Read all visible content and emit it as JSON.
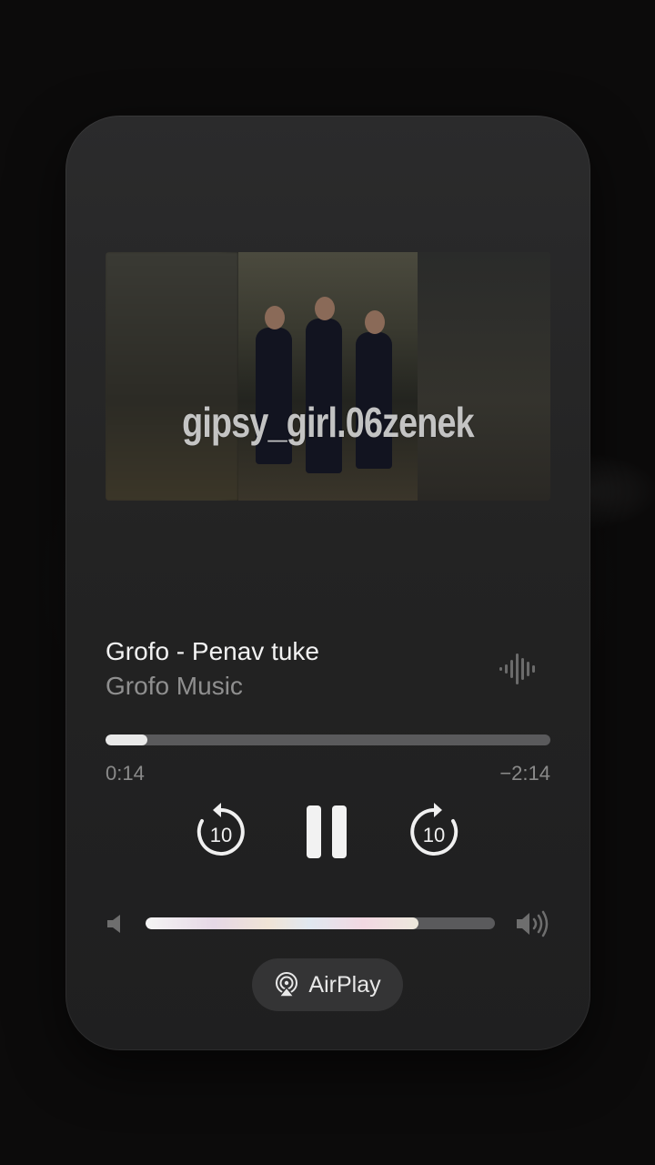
{
  "now_playing": {
    "title": "Grofo - Penav tuke",
    "artist": "Grofo Music",
    "artwork_watermark": "gipsy_girl.06zenek",
    "elapsed": "0:14",
    "remaining": "−2:14",
    "progress_fraction": 0.095
  },
  "controls": {
    "skip_back_seconds": "10",
    "skip_forward_seconds": "10",
    "state_icon": "pause-icon"
  },
  "volume": {
    "level_fraction": 0.78
  },
  "airplay": {
    "label": "AirPlay"
  },
  "colors": {
    "card_bg": "#262627",
    "track": "#5a5a5c",
    "fill": "#e9e9e9"
  }
}
